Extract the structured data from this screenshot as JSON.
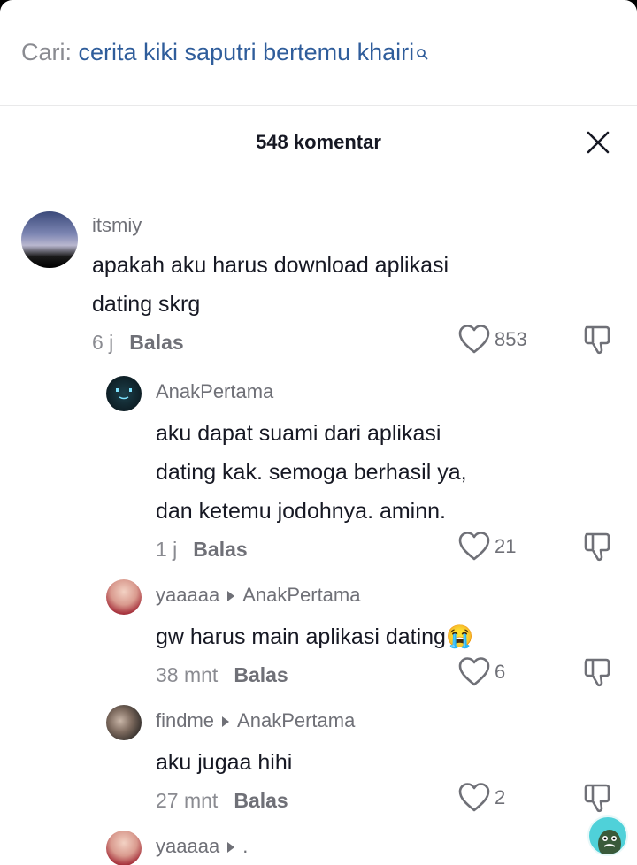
{
  "search": {
    "prefix": "Cari:",
    "query": "cerita kiki saputri bertemu khairi"
  },
  "header": {
    "title": "548 komentar"
  },
  "comments": [
    {
      "username": "itsmiy",
      "lines": [
        "apakah aku harus download aplikasi",
        "dating skrg"
      ],
      "time": "6 j",
      "reply_label": "Balas",
      "likes": "853"
    },
    {
      "username": "AnakPertama",
      "lines": [
        "aku dapat suami dari aplikasi",
        "dating kak. semoga berhasil ya,",
        "dan ketemu jodohnya. aminn."
      ],
      "time": "1 j",
      "reply_label": "Balas",
      "likes": "21"
    },
    {
      "username": "yaaaaa",
      "reply_to": "AnakPertama",
      "lines": [
        "gw harus main aplikasi dating😭"
      ],
      "time": "38 mnt",
      "reply_label": "Balas",
      "likes": "6"
    },
    {
      "username": "findme",
      "reply_to": "AnakPertama",
      "lines": [
        "aku jugaa hihi"
      ],
      "time": "27 mnt",
      "reply_label": "Balas",
      "likes": "2"
    },
    {
      "username": "yaaaaa",
      "reply_to": "."
    }
  ],
  "icons": {
    "search": "search-icon",
    "close": "close-icon",
    "like": "heart-outline-icon",
    "dislike": "thumbs-down-icon",
    "reply_arrow": "caret-right-icon"
  },
  "colors": {
    "text_primary": "#161823",
    "text_secondary": "#8a8b91",
    "search_query": "#2f5d9b"
  }
}
